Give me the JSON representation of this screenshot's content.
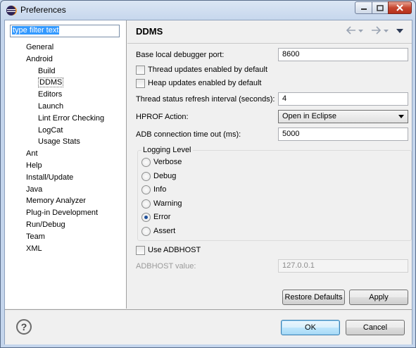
{
  "window": {
    "title": "Preferences"
  },
  "filter": {
    "text": "type filter text"
  },
  "tree": [
    {
      "label": "General",
      "indent": 1
    },
    {
      "label": "Android",
      "indent": 1
    },
    {
      "label": "Build",
      "indent": 2
    },
    {
      "label": "DDMS",
      "indent": 2,
      "selected": true
    },
    {
      "label": "Editors",
      "indent": 2
    },
    {
      "label": "Launch",
      "indent": 2
    },
    {
      "label": "Lint Error Checking",
      "indent": 2
    },
    {
      "label": "LogCat",
      "indent": 2
    },
    {
      "label": "Usage Stats",
      "indent": 2
    },
    {
      "label": "Ant",
      "indent": 1
    },
    {
      "label": "Help",
      "indent": 1
    },
    {
      "label": "Install/Update",
      "indent": 1
    },
    {
      "label": "Java",
      "indent": 1
    },
    {
      "label": "Memory Analyzer",
      "indent": 1
    },
    {
      "label": "Plug-in Development",
      "indent": 1
    },
    {
      "label": "Run/Debug",
      "indent": 1
    },
    {
      "label": "Team",
      "indent": 1
    },
    {
      "label": "XML",
      "indent": 1
    }
  ],
  "page": {
    "title": "DDMS",
    "debugger_port_label": "Base local debugger port:",
    "debugger_port_value": "8600",
    "thread_updates_label": "Thread updates enabled by default",
    "heap_updates_label": "Heap updates enabled by default",
    "refresh_interval_label": "Thread status refresh interval (seconds):",
    "refresh_interval_value": "4",
    "hprof_label": "HPROF Action:",
    "hprof_value": "Open in Eclipse",
    "adb_timeout_label": "ADB connection time out (ms):",
    "adb_timeout_value": "5000",
    "logging_level_title": "Logging Level",
    "logging_levels": [
      "Verbose",
      "Debug",
      "Info",
      "Warning",
      "Error",
      "Assert"
    ],
    "logging_level_selected": "Error",
    "use_adbhost_label": "Use ADBHOST",
    "adbhost_value_label": "ADBHOST value:",
    "adbhost_value": "127.0.0.1",
    "restore_defaults": "Restore Defaults",
    "apply": "Apply"
  },
  "footer": {
    "ok": "OK",
    "cancel": "Cancel"
  },
  "icons": {
    "app": "eclipse-icon",
    "help": "help-icon",
    "back": "back-arrow-icon",
    "forward": "forward-arrow-icon",
    "menu": "view-menu-icon"
  }
}
